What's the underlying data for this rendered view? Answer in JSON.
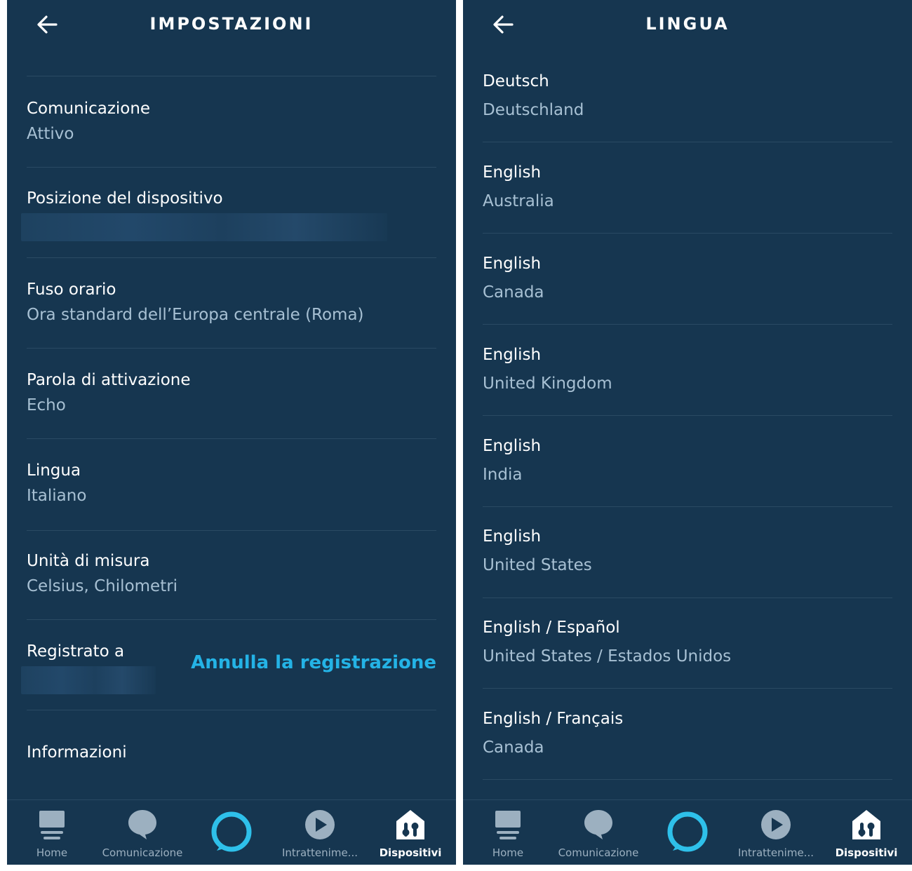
{
  "left": {
    "title": "IMPOSTAZIONI",
    "items": [
      {
        "label": "Comunicazione",
        "value": "Attivo"
      },
      {
        "label": "Posizione del dispositivo",
        "value": ""
      },
      {
        "label": "Fuso orario",
        "value": "Ora standard dell’Europa centrale (Roma)"
      },
      {
        "label": "Parola di attivazione",
        "value": "Echo"
      },
      {
        "label": "Lingua",
        "value": "Italiano"
      },
      {
        "label": "Unità di misura",
        "value": "Celsius, Chilometri"
      },
      {
        "label": "Registrato a",
        "value": "",
        "action": "Annulla la registrazione"
      },
      {
        "label": "Informazioni"
      }
    ]
  },
  "right": {
    "title": "LINGUA",
    "items": [
      {
        "label": "Deutsch",
        "value": "Deutschland"
      },
      {
        "label": "English",
        "value": "Australia"
      },
      {
        "label": "English",
        "value": "Canada"
      },
      {
        "label": "English",
        "value": "United Kingdom"
      },
      {
        "label": "English",
        "value": "India"
      },
      {
        "label": "English",
        "value": "United States"
      },
      {
        "label": "English / Español",
        "value": "United States / Estados Unidos"
      },
      {
        "label": "English / Français",
        "value": "Canada"
      }
    ]
  },
  "nav": {
    "items": [
      {
        "label": "Home",
        "icon": "home-icon"
      },
      {
        "label": "Comunicazione",
        "icon": "chat-bubble-icon"
      },
      {
        "label": "",
        "icon": "alexa-ring-icon"
      },
      {
        "label": "Intrattenime...",
        "icon": "play-icon"
      },
      {
        "label": "Dispositivi",
        "icon": "devices-icon",
        "active": true
      }
    ]
  },
  "colors": {
    "background": "#163650",
    "secondary_text": "#a7c0d3",
    "link": "#24b3e6",
    "alexa_ring": "#2ec0ea",
    "nav_inactive": "#9cb0c0"
  }
}
